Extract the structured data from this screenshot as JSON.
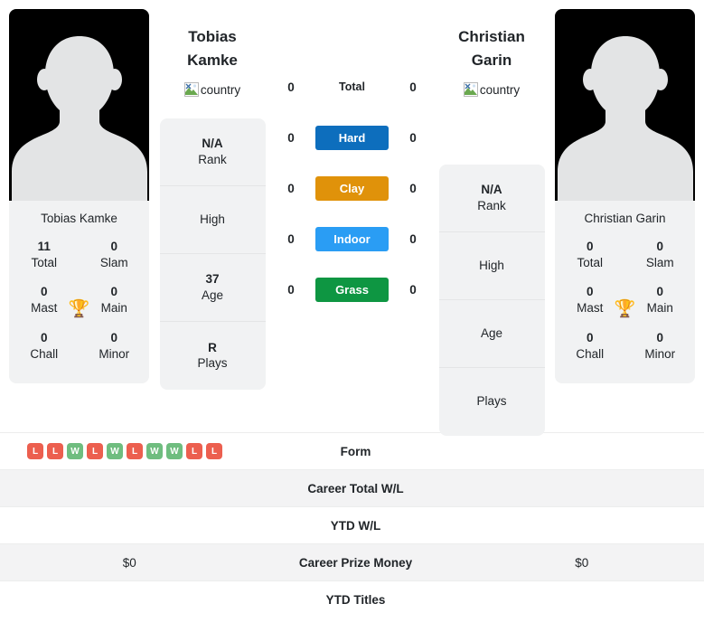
{
  "players": {
    "left": {
      "first_name": "Tobias",
      "last_name": "Kamke",
      "full_name": "Tobias Kamke",
      "country_alt": "country",
      "titles": {
        "total_val": "11",
        "total_lbl": "Total",
        "slam_val": "0",
        "slam_lbl": "Slam",
        "mast_val": "0",
        "mast_lbl": "Mast",
        "main_val": "0",
        "main_lbl": "Main",
        "chall_val": "0",
        "chall_lbl": "Chall",
        "minor_val": "0",
        "minor_lbl": "Minor"
      },
      "info": [
        {
          "value": "N/A",
          "label": "Rank"
        },
        {
          "value": "",
          "label": "High"
        },
        {
          "value": "37",
          "label": "Age"
        },
        {
          "value": "R",
          "label": "Plays"
        }
      ],
      "form": [
        "L",
        "L",
        "W",
        "L",
        "W",
        "L",
        "W",
        "W",
        "L",
        "L"
      ],
      "career_total_wl": "",
      "ytd_wl": "",
      "career_prize_money": "$0",
      "ytd_titles": ""
    },
    "right": {
      "first_name": "Christian",
      "last_name": "Garin",
      "full_name": "Christian Garin",
      "country_alt": "country",
      "titles": {
        "total_val": "0",
        "total_lbl": "Total",
        "slam_val": "0",
        "slam_lbl": "Slam",
        "mast_val": "0",
        "mast_lbl": "Mast",
        "main_val": "0",
        "main_lbl": "Main",
        "chall_val": "0",
        "chall_lbl": "Chall",
        "minor_val": "0",
        "minor_lbl": "Minor"
      },
      "info": [
        {
          "value": "N/A",
          "label": "Rank"
        },
        {
          "value": "",
          "label": "High"
        },
        {
          "value": "",
          "label": "Age"
        },
        {
          "value": "",
          "label": "Plays"
        }
      ],
      "form": [],
      "career_total_wl": "",
      "ytd_wl": "",
      "career_prize_money": "$0",
      "ytd_titles": ""
    }
  },
  "surfaces": [
    {
      "label": "Total",
      "left_score": "0",
      "right_score": "0",
      "color": "none",
      "text_color": "#212529"
    },
    {
      "label": "Hard",
      "left_score": "0",
      "right_score": "0",
      "color": "#0d6ebd",
      "text_color": "#ffffff"
    },
    {
      "label": "Clay",
      "left_score": "0",
      "right_score": "0",
      "color": "#e0920a",
      "text_color": "#ffffff"
    },
    {
      "label": "Indoor",
      "left_score": "0",
      "right_score": "0",
      "color": "#2a9df4",
      "text_color": "#ffffff"
    },
    {
      "label": "Grass",
      "left_score": "0",
      "right_score": "0",
      "color": "#0e9642",
      "text_color": "#ffffff"
    }
  ],
  "table_rows": [
    {
      "label": "Form",
      "left": "",
      "right": "",
      "striped": false,
      "form": true
    },
    {
      "label": "Career Total W/L",
      "left": "",
      "right": "",
      "striped": true,
      "form": false
    },
    {
      "label": "YTD W/L",
      "left": "",
      "right": "",
      "striped": false,
      "form": false
    },
    {
      "label": "Career Prize Money",
      "left": "$0",
      "right": "$0",
      "striped": true,
      "form": false
    },
    {
      "label": "YTD Titles",
      "left": "",
      "right": "",
      "striped": false,
      "form": false
    }
  ],
  "colors": {
    "win_badge": "#6fbd7f",
    "loss_badge": "#ec5f4f",
    "panel_bg": "#f1f2f3",
    "stripe_bg": "#f3f3f4",
    "trophy": "#3d6fb4"
  },
  "icons": {
    "trophy": "🏆",
    "broken_image": "broken-image-icon"
  }
}
